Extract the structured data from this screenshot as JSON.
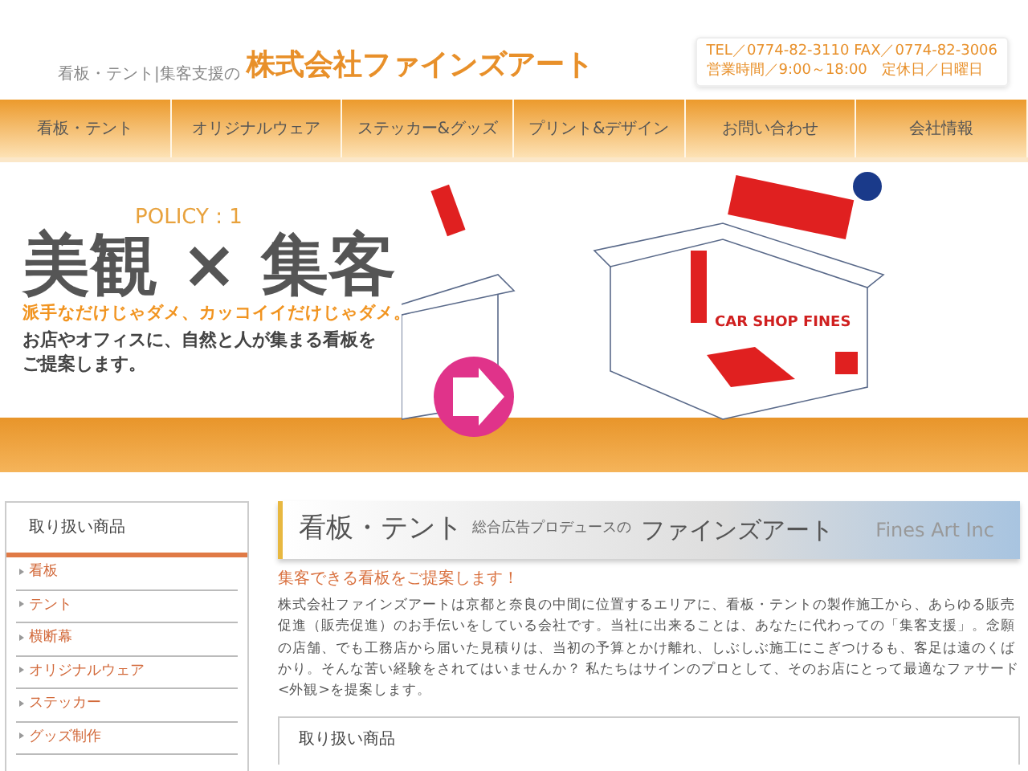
{
  "header": {
    "tagline": "看板・テント|集客支援の",
    "company": "株式会社ファインズアート",
    "contact": [
      "TEL／0774-82-3110  FAX／0774-82-3006",
      "営業時間／9:00～18:00　定休日／日曜日"
    ]
  },
  "nav": [
    "看板・テント",
    "オリジナルウェア",
    "ステッカー&グッズ",
    "プリント&デザイン",
    "お問い合わせ",
    "会社情報"
  ],
  "banner": {
    "policy": "POLICY : 1",
    "headline": "美観 × 集客",
    "catch": "派手なだけじゃダメ、カッコイイだけじゃダメ。",
    "lead": "お店やオフィスに、自然と人が集まる看板をご提案します。",
    "shop_sign": "CAR SHOP FINES"
  },
  "sidebar": {
    "title": "取り扱い商品",
    "items": [
      "看板",
      "テント",
      "横断幕",
      "オリジナルウェア",
      "ステッカー",
      "グッズ制作"
    ]
  },
  "content": {
    "title": "看板・テント",
    "subtitle": "総合広告プロデュースの",
    "brand": "ファインズアート",
    "watermark": "Fines Art Inc",
    "heading": "集客できる看板をご提案します！",
    "body": "株式会社ファインズアートは京都と奈良の中間に位置するエリアに、看板・テントの製作施工から、あらゆる販売促進（販売促進）のお手伝いをしている会社です。当社に出来ることは、あなたに代わっての「集客支援」。念願の店舗、でも工務店から届いた見積りは、当初の予算とかけ離れ、しぶしぶ施工にこぎつけるも、客足は遠のくばかり。そんな苦い経験をされてはいませんか？ 私たちはサインのプロとして、そのお店にとって最適なファサード<外観>を提案します。",
    "section_title": "取り扱い商品"
  }
}
